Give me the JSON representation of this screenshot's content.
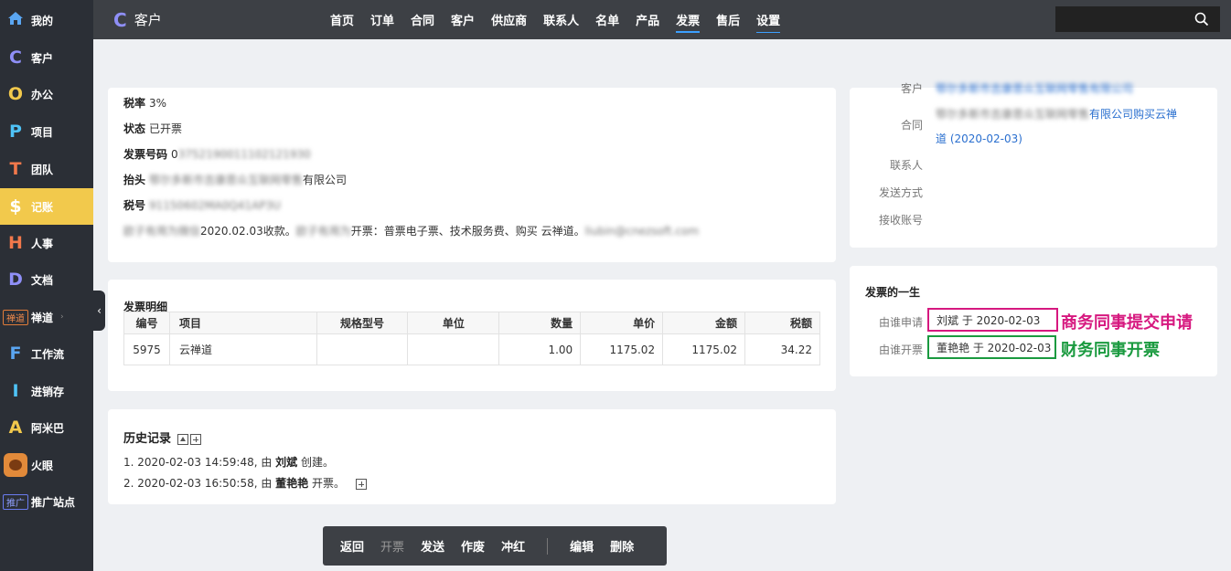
{
  "sidebar": {
    "items": [
      {
        "icon": "home-icon",
        "glyph": "",
        "label": "我的",
        "color": "#5aa6f2"
      },
      {
        "icon": "c-letter-icon",
        "glyph": "C",
        "label": "客户",
        "color": "#8f8ff7"
      },
      {
        "icon": "o-letter-icon",
        "glyph": "O",
        "label": "办公",
        "color": "#f2c94c"
      },
      {
        "icon": "p-letter-icon",
        "glyph": "P",
        "label": "项目",
        "color": "#4fc3f7"
      },
      {
        "icon": "t-letter-icon",
        "glyph": "T",
        "label": "团队",
        "color": "#f2784b"
      },
      {
        "icon": "dollar-icon",
        "glyph": "$",
        "label": "记账",
        "color": "#ffffff"
      },
      {
        "icon": "h-letter-icon",
        "glyph": "H",
        "label": "人事",
        "color": "#f2784b"
      },
      {
        "icon": "d-letter-icon",
        "glyph": "D",
        "label": "文档",
        "color": "#8f8ff7"
      },
      {
        "icon": "chandao-badge-icon",
        "glyph": "禅道",
        "label": "禅道",
        "color": "#f08a4b"
      },
      {
        "icon": "f-letter-icon",
        "glyph": "F",
        "label": "工作流",
        "color": "#5aa6f2"
      },
      {
        "icon": "i-letter-icon",
        "glyph": "I",
        "label": "进销存",
        "color": "#4fc3f7"
      },
      {
        "icon": "a-letter-icon",
        "glyph": "A",
        "label": "阿米巴",
        "color": "#f2c94c"
      },
      {
        "icon": "fire-eye-icon",
        "glyph": "",
        "label": "火眼",
        "color": "#e28a3a"
      },
      {
        "icon": "promo-badge-icon",
        "glyph": "推广",
        "label": "推广站点",
        "color": "#8fa0ff"
      }
    ]
  },
  "topbar": {
    "brand_glyph": "C",
    "brand_title": "客户",
    "nav": [
      "首页",
      "订单",
      "合同",
      "客户",
      "供应商",
      "联系人",
      "名单",
      "产品",
      "发票",
      "售后",
      "设置"
    ]
  },
  "invoice": {
    "tax_rate_label": "税率",
    "tax_rate": "3%",
    "status_label": "状态",
    "status": "已开票",
    "number_label": "发票号码",
    "number_prefix": "0",
    "number_blurred": "3752190011102121930",
    "header_label": "抬头",
    "header_blurred": "鄂尔多斯市吉康恩众互联网零售",
    "header_suffix": "有限公司",
    "taxno_label": "税号",
    "taxno_blurred": "91150602MA0Q41AP3U",
    "note_blur1": "欧子有用为微信",
    "note_text1": "2020.02.03收款。",
    "note_blur2": "欧子有用为",
    "note_text2": "开票：普票电子票、技术服务费、购买 云禅道。",
    "note_blur3": "liubin@cnezsoft.com"
  },
  "detail": {
    "title": "发票明细",
    "headers": [
      "编号",
      "项目",
      "规格型号",
      "单位",
      "数量",
      "单价",
      "金额",
      "税额"
    ],
    "rows": [
      [
        "5975",
        "云禅道",
        "",
        "",
        "1.00",
        "1175.02",
        "1175.02",
        "34.22"
      ]
    ]
  },
  "history": {
    "title": "历史记录",
    "line1_pre": "1. 2020-02-03 14:59:48, 由 ",
    "line1_name": "刘斌",
    "line1_post": " 创建。",
    "line2_pre": "2. 2020-02-03 16:50:58, 由 ",
    "line2_name": "董艳艳",
    "line2_post": " 开票。"
  },
  "toolbar": {
    "back": "返回",
    "issue": "开票",
    "send": "发送",
    "void": "作废",
    "redflush": "冲红",
    "edit": "编辑",
    "delete": "删除"
  },
  "relation": {
    "top_label": "客户",
    "top_link_blurred": "鄂尔多斯市吉康恩众互联网零售有限公司",
    "contract_label": "合同",
    "contract_blurred": "鄂尔多斯市吉康恩众互联网零售",
    "contract_text1": "有限公司购买云禅",
    "contract_text2": "道 (2020-02-03)",
    "contact_label": "联系人",
    "send_label": "发送方式",
    "account_label": "接收账号"
  },
  "lifecycle": {
    "title": "发票的一生",
    "applied_label": "由谁申请",
    "applied_value": "刘斌 于 2020-02-03",
    "issued_label": "由谁开票",
    "issued_value": "董艳艳 于 2020-02-03",
    "annot1": "商务同事提交申请",
    "annot2": "财务同事开票",
    "annot1_color": "#d6187f",
    "annot2_color": "#1a9a3f"
  }
}
